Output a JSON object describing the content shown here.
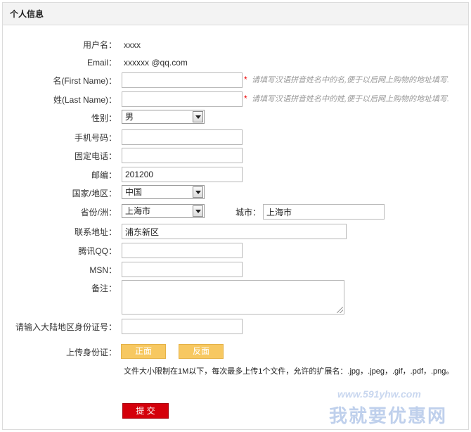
{
  "header": {
    "title": "个人信息"
  },
  "username": {
    "label": "用户名：",
    "value": "xxxx"
  },
  "email": {
    "label": "Email：",
    "value": "xxxxxx @qq.com"
  },
  "first_name": {
    "label": "名(First Name)：",
    "value": "",
    "required_mark": "*",
    "hint": "请填写汉语拼音姓名中的名,便于以后网上购物的地址填写."
  },
  "last_name": {
    "label": "姓(Last Name)：",
    "value": "",
    "required_mark": "*",
    "hint": "请填写汉语拼音姓名中的姓,便于以后网上购物的地址填写."
  },
  "gender": {
    "label": "性别：",
    "selected": "男"
  },
  "mobile": {
    "label": "手机号码：",
    "value": ""
  },
  "phone": {
    "label": "固定电话：",
    "value": ""
  },
  "postcode": {
    "label": "邮编：",
    "value": "201200"
  },
  "country": {
    "label": "国家/地区：",
    "selected": "中国"
  },
  "province": {
    "label": "省份/洲：",
    "selected": "上海市"
  },
  "city": {
    "label": "城市：",
    "value": "上海市"
  },
  "address": {
    "label": "联系地址：",
    "value": "浦东新区"
  },
  "qq": {
    "label": "腾讯QQ：",
    "value": ""
  },
  "msn": {
    "label": "MSN：",
    "value": ""
  },
  "remarks": {
    "label": "备注：",
    "value": ""
  },
  "id_number": {
    "label": "请输入大陆地区身份证号：",
    "value": ""
  },
  "id_upload": {
    "label": "上传身份证：",
    "front_label": "正面",
    "back_label": "反面",
    "note": "文件大小限制在1M以下，每次最多上传1个文件，允许的扩展名：.jpg，.jpeg，.gif，.pdf，.png。"
  },
  "submit": {
    "label": "提 交"
  },
  "watermark": {
    "url": "www.591yhw.com",
    "name": "我就要优惠网"
  }
}
